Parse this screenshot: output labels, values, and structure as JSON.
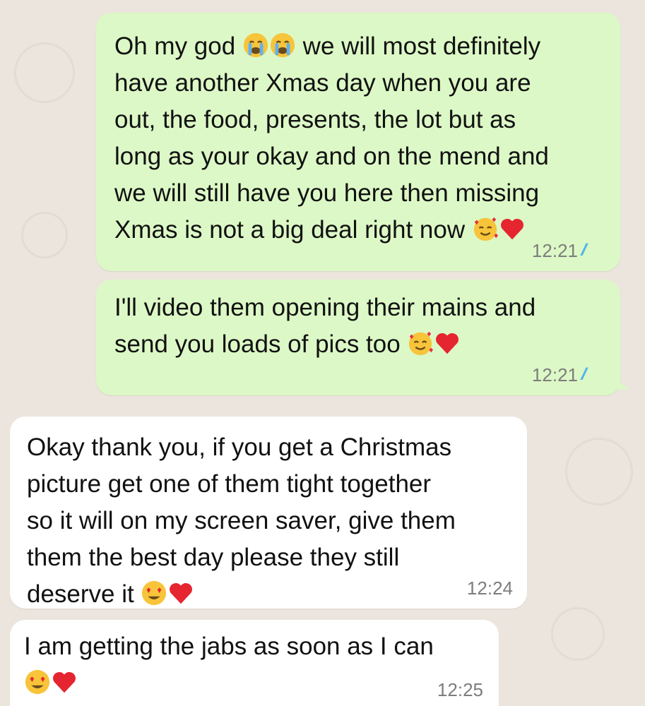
{
  "messages": [
    {
      "direction": "outgoing",
      "lines": [
        "Oh my god",
        "we will most definitely",
        "have another Xmas day when you are",
        "out, the food, presents, the lot but as",
        "long as your okay and on the mend and",
        "we will still have you here then missing",
        "Xmas is not a big deal right now"
      ],
      "time": "12:21",
      "ticks": "//"
    },
    {
      "direction": "outgoing",
      "lines": [
        "I'll video them opening their mains and",
        "send you loads of pics too"
      ],
      "time": "12:21",
      "ticks": "//"
    },
    {
      "direction": "incoming",
      "lines": [
        "Okay thank you, if you get a Christmas",
        "picture get one of them tight together",
        "so it will on my screen saver, give them",
        "them the best day please they still",
        "deserve it"
      ],
      "time": "12:24"
    },
    {
      "direction": "incoming",
      "lines": [
        "I am getting the jabs as soon as I can"
      ],
      "time": "12:25"
    }
  ],
  "emoji_names": {
    "crying": "loudly-crying-face",
    "hearts_face": "smiling-face-with-hearts",
    "heart": "red-heart",
    "heart_eyes": "smiling-face-with-heart-eyes"
  },
  "colors": {
    "outgoing_bubble": "#dcf8c6",
    "incoming_bubble": "#ffffff",
    "background": "#ebe5dd",
    "read_ticks": "#4fb6ec",
    "timestamp": "#7d7d7d"
  }
}
